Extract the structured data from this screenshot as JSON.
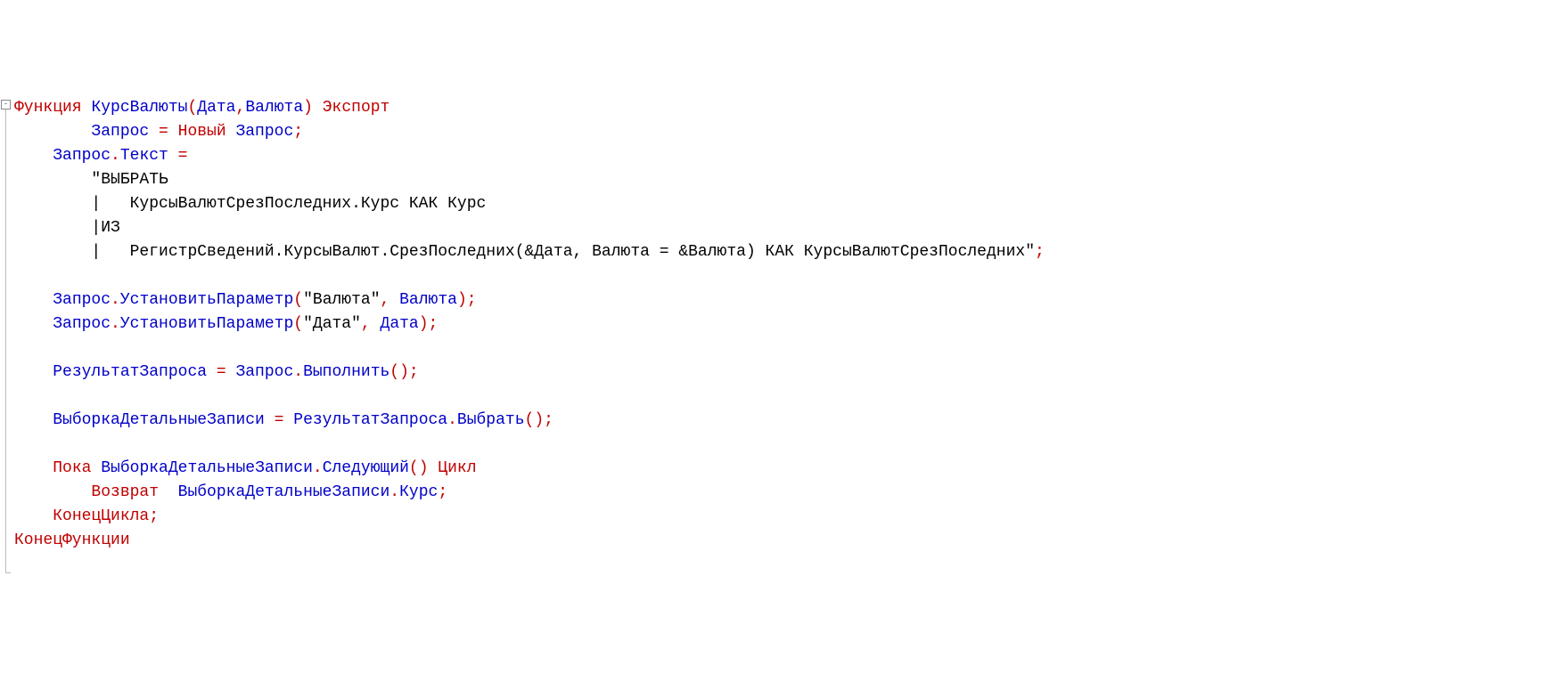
{
  "fold_marker": "-",
  "line1": {
    "t1": "Функция",
    "t2": "КурсВалюты",
    "t3": "(",
    "t4": "Дата",
    "t5": ",",
    "t6": "Валюта",
    "t7": ")",
    "t8": "Экспорт"
  },
  "line2": {
    "t1": "Запрос",
    "t2": " = ",
    "t3": "Новый",
    "t4": " Запрос",
    "t5": ";"
  },
  "line3": {
    "t1": "Запрос",
    "t2": ".",
    "t3": "Текст",
    "t4": " ="
  },
  "line4": {
    "t1": "\"ВЫБРАТЬ"
  },
  "line5": {
    "t1": "|   КурсыВалютСрезПоследних.Курс КАК Курс"
  },
  "line6": {
    "t1": "|ИЗ"
  },
  "line7": {
    "t1": "|   РегистрСведений.КурсыВалют.СрезПоследних(&Дата, Валюта = &Валюта) КАК КурсыВалютСрезПоследних\"",
    "t2": ";"
  },
  "line9": {
    "t1": "Запрос",
    "t2": ".",
    "t3": "УстановитьПараметр",
    "t4": "(",
    "t5": "\"Валюта\"",
    "t6": ",",
    "t7": " Валюта",
    "t8": ");"
  },
  "line10": {
    "t1": "Запрос",
    "t2": ".",
    "t3": "УстановитьПараметр",
    "t4": "(",
    "t5": "\"Дата\"",
    "t6": ",",
    "t7": " Дата",
    "t8": ");"
  },
  "line12": {
    "t1": "РезультатЗапроса",
    "t2": " = ",
    "t3": "Запрос",
    "t4": ".",
    "t5": "Выполнить",
    "t6": "();"
  },
  "line14": {
    "t1": "ВыборкаДетальныеЗаписи",
    "t2": " = ",
    "t3": "РезультатЗапроса",
    "t4": ".",
    "t5": "Выбрать",
    "t6": "();"
  },
  "line16": {
    "t1": "Пока",
    "t2": " ВыборкаДетальныеЗаписи",
    "t3": ".",
    "t4": "Следующий",
    "t5": "()",
    "t6": " Цикл"
  },
  "line17": {
    "t1": "Возврат",
    "t2": "  ВыборкаДетальныеЗаписи",
    "t3": ".",
    "t4": "Курс",
    "t5": ";"
  },
  "line18": {
    "t1": "КонецЦикла",
    "t2": ";"
  },
  "line19": {
    "t1": "КонецФункции"
  }
}
